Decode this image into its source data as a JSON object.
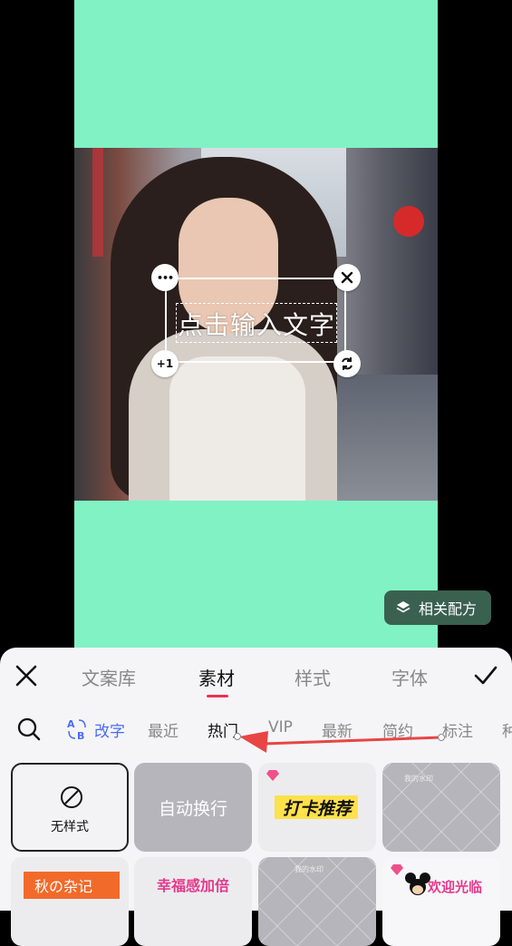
{
  "canvas": {
    "text_placeholder": "点击输入文字",
    "handle_more": "•••",
    "handle_plus": "+1",
    "recipe_button": "相关配方"
  },
  "panel": {
    "tabs": [
      {
        "label": "文案库"
      },
      {
        "label": "素材"
      },
      {
        "label": "样式"
      },
      {
        "label": "字体"
      }
    ],
    "subtabs": [
      {
        "label": "改字"
      },
      {
        "label": "最近"
      },
      {
        "label": "热门"
      },
      {
        "label": "VIP"
      },
      {
        "label": "最新"
      },
      {
        "label": "简约"
      },
      {
        "label": "标注"
      },
      {
        "label": "种"
      }
    ],
    "styles": [
      {
        "label": "无样式"
      },
      {
        "label": "自动换行"
      },
      {
        "label": "打卡推荐"
      },
      {
        "label": "我的水印"
      },
      {
        "label": "秋の杂记"
      },
      {
        "label": "幸福感加倍"
      },
      {
        "label": "我的水印"
      },
      {
        "label": "欢迎光临"
      }
    ]
  },
  "colors": {
    "background_green": "#80f2c4",
    "accent_pink": "#ef2f55",
    "accent_blue": "#4a6cf7",
    "arrow_red": "#e84545"
  }
}
